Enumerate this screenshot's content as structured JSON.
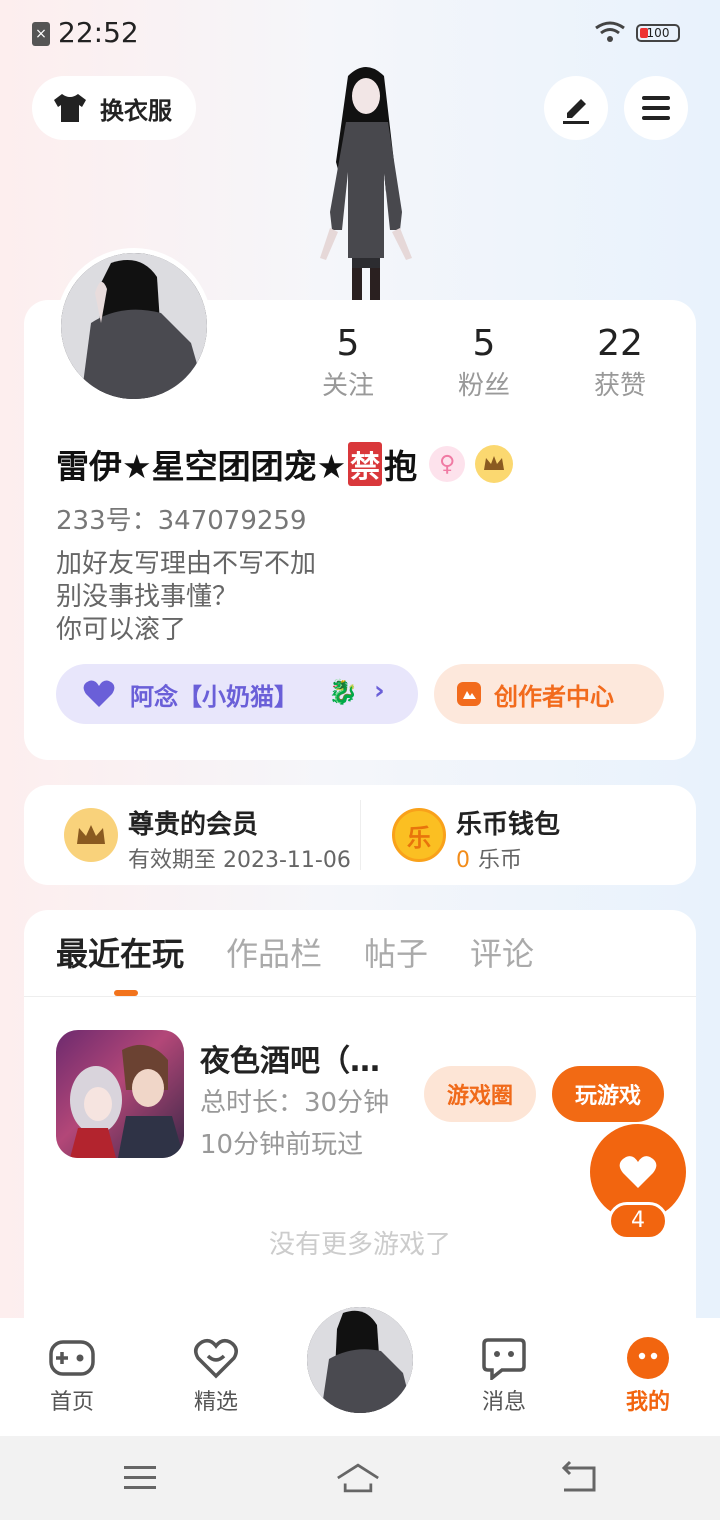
{
  "status_bar": {
    "time": "22:52",
    "battery": "100"
  },
  "header": {
    "outfit_label": "换衣服"
  },
  "profile": {
    "stats": [
      {
        "value": "5",
        "label": "关注"
      },
      {
        "value": "5",
        "label": "粉丝"
      },
      {
        "value": "22",
        "label": "获赞"
      }
    ],
    "nickname_prefix": "雷伊★星空团团宠★",
    "nickname_ban": "禁",
    "nickname_suffix": "抱",
    "uid": "233号：347079259",
    "bio": [
      "加好友写理由不写不加",
      "别没事找事懂？",
      "你可以滚了"
    ],
    "pet_label": "阿念【小奶猫】",
    "creator_label": "创作者中心"
  },
  "membership": {
    "title": "尊贵的会员",
    "expiry": "有效期至 2023-11-06",
    "wallet_title": "乐币钱包",
    "wallet_amount": "0",
    "wallet_unit": "乐币",
    "coin_char": "乐"
  },
  "tabs": [
    {
      "label": "最近在玩",
      "active": true
    },
    {
      "label": "作品栏",
      "active": false
    },
    {
      "label": "帖子",
      "active": false
    },
    {
      "label": "评论",
      "active": false
    }
  ],
  "recent_game": {
    "title": "夜色酒吧（…",
    "duration": "总时长：30分钟",
    "last_played": "10分钟前玩过",
    "circle_label": "游戏圈",
    "play_label": "玩游戏"
  },
  "like_count": "4",
  "empty_text": "没有更多游戏了",
  "bottom_nav": [
    {
      "label": "首页",
      "icon": "gamepad-icon"
    },
    {
      "label": "精选",
      "icon": "heart-chat-icon"
    },
    {
      "label": "消息",
      "icon": "message-icon"
    },
    {
      "label": "我的",
      "icon": "profile-dots-icon",
      "active": true
    }
  ],
  "colors": {
    "accent": "#f2650f",
    "purple": "#6a5fd8",
    "gold": "#f9d27b"
  }
}
